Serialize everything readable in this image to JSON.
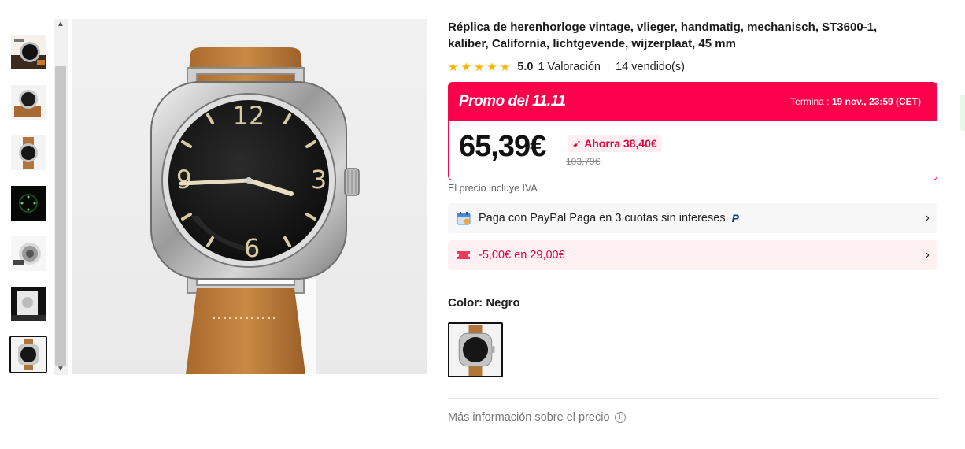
{
  "product": {
    "title": "Réplica de herenhorloge vintage, vlieger, handmatig, mechanisch, ST3600-1, kaliber, California, lichtgevende, wijzerplaat, 45 mm",
    "rating_score": "5.0",
    "rating_count": "1 Valoración",
    "sold_count": "14 vendido(s)",
    "stars": 5
  },
  "promo": {
    "title": "Promo del 11.11",
    "ends_label": "Termina :",
    "ends_value": "19 nov., 23:59 (CET)",
    "price": "65,39€",
    "save": "Ahorra 38,40€",
    "old_price": "103,79€"
  },
  "vat_note": "El precio incluye IVA",
  "payment": {
    "paypal_text": "Paga con PayPal Paga en 3 cuotas sin intereses",
    "paypal_logo": "P",
    "coupon_text": "-5,00€ en 29,00€",
    "coupon_icon": "%"
  },
  "color": {
    "label": "Color: Negro"
  },
  "more_info": "Más información sobre el precio",
  "icons": {
    "rail_up": "▲",
    "rail_down": "▼",
    "chevron": "›",
    "info": "i",
    "star": "★"
  },
  "colors": {
    "accent": "#fd004c",
    "star": "#f7b500",
    "save": "#e0063f"
  }
}
